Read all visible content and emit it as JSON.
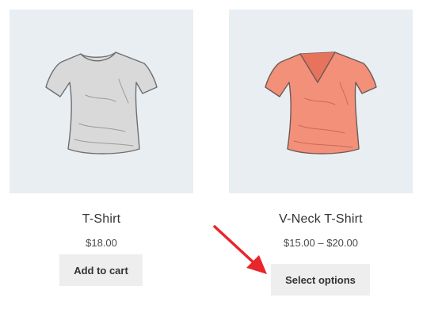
{
  "products": [
    {
      "name": "T-Shirt",
      "price": "$18.00",
      "button_label": "Add to cart",
      "image_icon": "gray-tshirt-icon",
      "shirt_color": "#d9d9d9"
    },
    {
      "name": "V-Neck T-Shirt",
      "price": "$15.00 – $20.00",
      "button_label": "Select options",
      "image_icon": "coral-vneck-tshirt-icon",
      "shirt_color": "#f2907a"
    }
  ],
  "annotation": {
    "arrow_color": "#e8262b",
    "arrow_icon": "red-arrow-icon"
  },
  "colors": {
    "thumb_background": "#e9eef3",
    "button_background": "#eeeeee"
  }
}
